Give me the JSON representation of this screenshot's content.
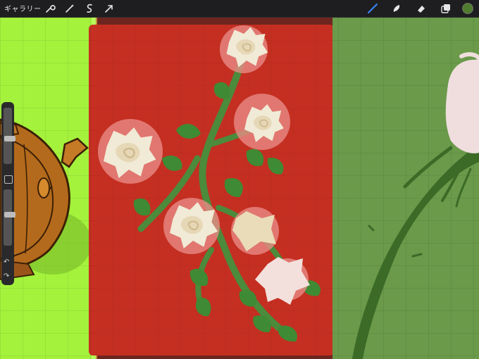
{
  "toolbar": {
    "gallery_label": "ギャラリー",
    "tools_left": [
      "wrench-icon",
      "magic-wand-icon",
      "selection-icon",
      "transform-arrow-icon"
    ],
    "tools_right": [
      "brush-icon",
      "smudge-icon",
      "eraser-icon",
      "layers-icon"
    ],
    "active_tool": "brush-icon",
    "active_color": "#4f7c2e"
  },
  "sidebar": {
    "brush_size_level": 0.45,
    "opacity_level": 0.55,
    "modify_button": "square-icon",
    "undo": "undo-icon",
    "redo": "redo-icon"
  },
  "canvas": {
    "panels": [
      {
        "name": "teapot-panel",
        "background": "#a4f23c"
      },
      {
        "name": "roses-panel",
        "background": "#c63022"
      },
      {
        "name": "rose-closeup-panel",
        "background": "#6a9a4a"
      }
    ],
    "grid": true
  }
}
